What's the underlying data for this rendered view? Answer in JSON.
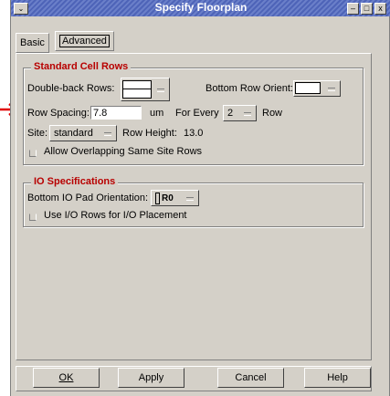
{
  "window": {
    "title": "Specify Floorplan",
    "menu_glyph": "⌄",
    "minimize_glyph": "–",
    "maximize_glyph": "□",
    "close_glyph": "x"
  },
  "tabs": [
    {
      "label": "Basic",
      "active": true
    },
    {
      "label": "Advanced",
      "active": false
    }
  ],
  "standard_cell_rows": {
    "title": "Standard Cell Rows",
    "double_back_label": "Double-back Rows:",
    "bottom_row_orient_label": "Bottom Row Orient:",
    "row_spacing_label": "Row Spacing:",
    "row_spacing_value": "7.8",
    "unit": "um",
    "for_every_label": "For Every",
    "for_every_value": "2",
    "row_label": "Row",
    "site_label": "Site:",
    "site_value": "standard",
    "row_height_label": "Row Height:",
    "row_height_value": "13.0",
    "allow_overlap_label": "Allow Overlapping Same Site Rows"
  },
  "io_specifications": {
    "title": "IO Specifications",
    "bottom_io_label": "Bottom IO Pad Orientation:",
    "bottom_io_value": "R0",
    "use_io_rows_label": "Use I/O Rows for I/O Placement"
  },
  "buttons": {
    "ok": "OK",
    "apply": "Apply",
    "cancel": "Cancel",
    "help": "Help"
  },
  "colors": {
    "section_title": "#b80000",
    "arrow": "#e00000",
    "title_bar": "#5a6fc0"
  }
}
